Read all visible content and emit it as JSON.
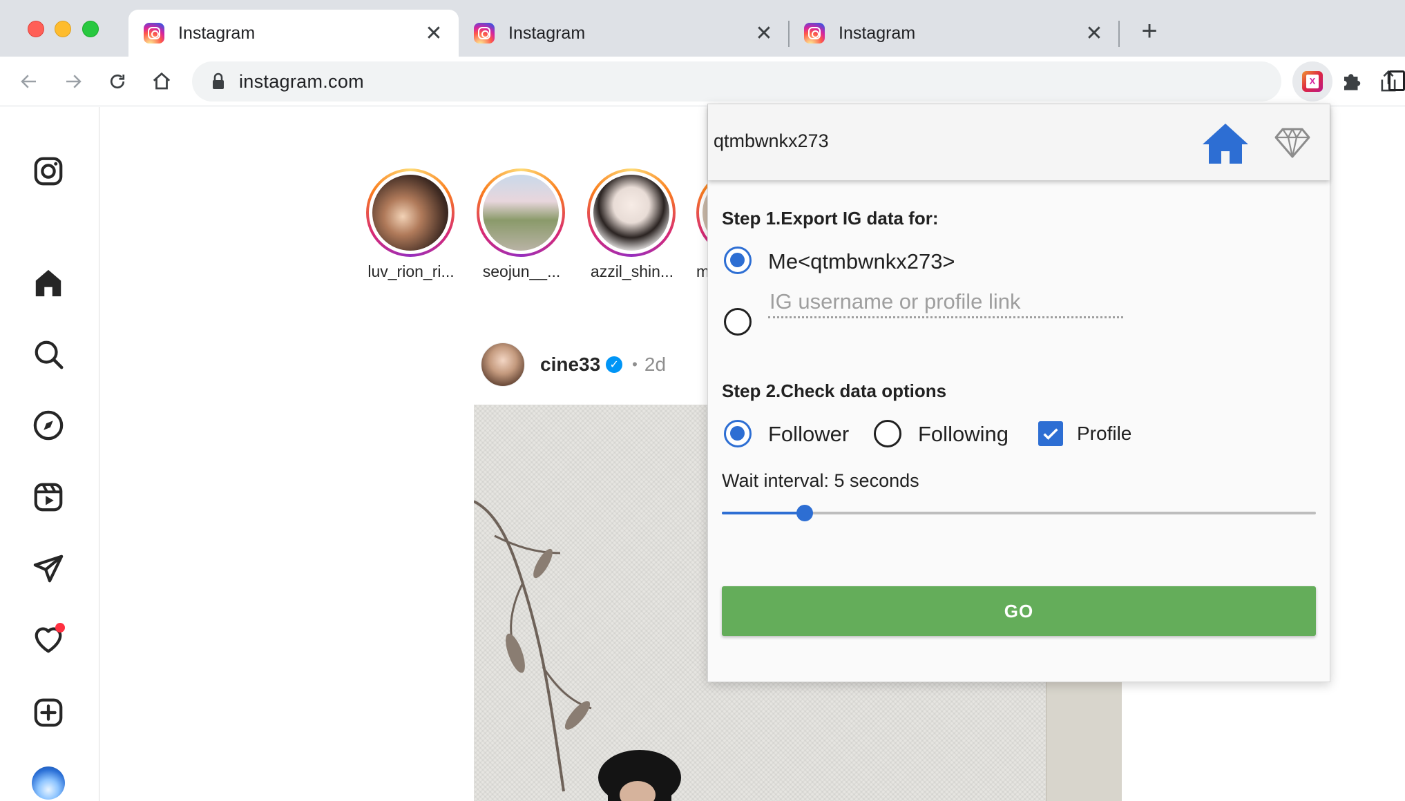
{
  "browser": {
    "tabs": [
      {
        "title": "Instagram",
        "active": true
      },
      {
        "title": "Instagram",
        "active": false
      },
      {
        "title": "Instagram",
        "active": false
      }
    ],
    "url": "instagram.com",
    "icons": [
      "back-icon",
      "forward-icon",
      "reload-icon",
      "home-icon",
      "lock-icon",
      "share-icon",
      "star-icon",
      "extension-icon",
      "puzzle-icon",
      "side-panel-icon"
    ]
  },
  "instagram": {
    "nav_icons": [
      "instagram-logo-icon",
      "home-icon",
      "search-icon",
      "explore-icon",
      "reels-icon",
      "messages-icon",
      "notifications-icon",
      "create-icon",
      "profile-avatar"
    ],
    "stories": [
      {
        "name": "luv_rion_ri..."
      },
      {
        "name": "seojun__..."
      },
      {
        "name": "azzil_shin..."
      },
      {
        "name": "m"
      }
    ],
    "post": {
      "username": "cine33",
      "separator": "•",
      "time": "2d"
    }
  },
  "popup": {
    "username": "qtmbwnkx273",
    "step1_title": "Step 1.Export IG data for:",
    "option_me": "Me<qtmbwnkx273>",
    "input_placeholder": "IG username or profile link",
    "input_value": "",
    "step2_title": "Step 2.Check data options",
    "options": {
      "follower": "Follower",
      "following": "Following",
      "profile": "Profile"
    },
    "selected": {
      "export_for": "me",
      "relation": "follower",
      "profile_checked": true
    },
    "wait_label": "Wait interval: 5 seconds",
    "slider_fraction": 0.14,
    "go_label": "GO",
    "colors": {
      "accent": "#2d6ed3",
      "go": "#64ad5a"
    }
  }
}
